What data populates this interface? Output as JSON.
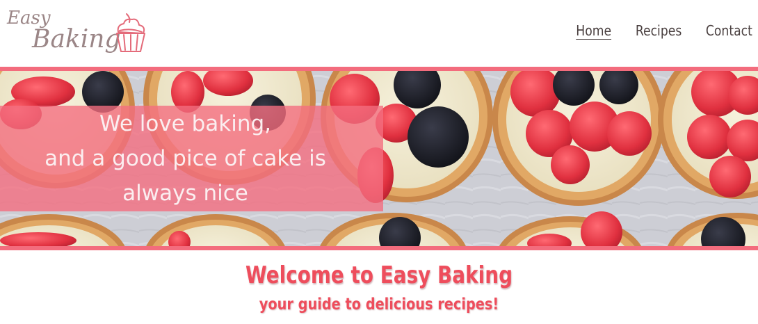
{
  "brand": {
    "line1": "Easy",
    "line2": "Baking"
  },
  "nav": {
    "items": [
      {
        "label": "Home",
        "active": true
      },
      {
        "label": "Recipes",
        "active": false
      },
      {
        "label": "Contact",
        "active": false
      }
    ]
  },
  "hero": {
    "lines": [
      "We love baking,",
      "and a good pice of cake is",
      "always nice"
    ]
  },
  "welcome": {
    "title": "Welcome to Easy Baking",
    "subtitle": "your guide to delicious recipes!"
  },
  "colors": {
    "accent": "#f36c7d",
    "heading": "#ee4d5c",
    "nav_text": "#4a4040",
    "logo_text": "#9b8687",
    "cupcake": "#e46b7a"
  },
  "icons": {
    "logo": "cupcake-icon"
  }
}
